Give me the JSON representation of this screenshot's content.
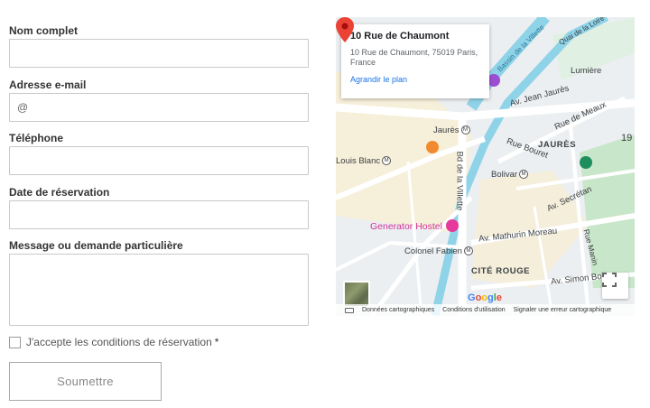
{
  "form": {
    "fields": [
      {
        "label": "Nom complet",
        "value": ""
      },
      {
        "label": "Adresse e-mail",
        "value": "@"
      },
      {
        "label": "Téléphone",
        "value": ""
      },
      {
        "label": "Date de réservation",
        "value": ""
      },
      {
        "label": "Message ou demande particulière",
        "value": ""
      }
    ],
    "consent_label": "J'accepte les conditions de réservation",
    "required_marker": "*",
    "submit_label": "Soumettre"
  },
  "map": {
    "card": {
      "title": "10 Rue de Chaumont",
      "address": "10 Rue de Chaumont, 75019 Paris, France",
      "link": "Agrandir le plan"
    },
    "labels": {
      "lumiere": "Lumière",
      "jean_jaures": "Av. Jean Jaurès",
      "meaux": "Rue de Meaux",
      "jaures_metro": "Jaurès",
      "jaures_district": "JAURÈS",
      "num19": "19",
      "louis_blanc": "Louis Blanc",
      "bourget": "Rue Bouret",
      "bolivar": "Bolivar",
      "villette": "Bd de la Villette",
      "generator": "Generator Hostel",
      "colonel": "Colonel Fabien",
      "mathurin": "Av. Mathurin Moreau",
      "cite_rouge": "CITÉ ROUGE",
      "simon": "Av. Simon Bolivar",
      "secretan": "Av. Secrétan",
      "quai_loire": "Quai de la Loire",
      "bassin": "Bassin de la Villette",
      "marin": "Rue Manin"
    },
    "google": "Google",
    "attribution": [
      "Données cartographiques",
      "Conditions d'utilisation",
      "Signaler une erreur cartographique"
    ],
    "colors": {
      "pin": "#ea4335",
      "water": "#8fd3e8",
      "link": "#1a73e8",
      "park": "#c8e6c9"
    }
  }
}
